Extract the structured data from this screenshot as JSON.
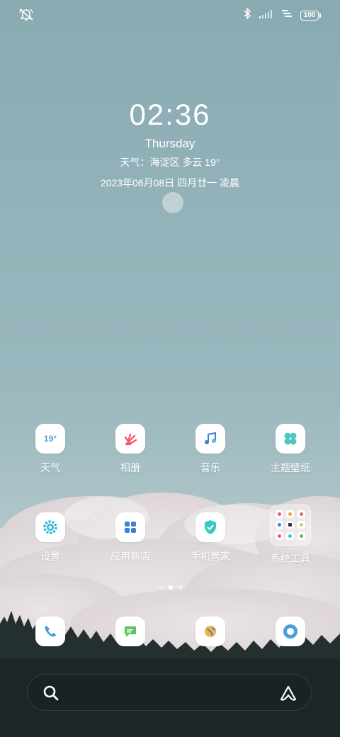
{
  "status_bar": {
    "battery": "100",
    "icons": [
      "mute-bell-icon",
      "bluetooth-icon",
      "signal-icon",
      "data-icon",
      "battery-icon"
    ]
  },
  "clock_widget": {
    "time": "02:36",
    "weekday": "Thursday",
    "weather": "天气：海淀区 多云 19°",
    "date": "2023年06月08日 四月廿一 凌晨"
  },
  "apps_row1": [
    {
      "label": "天气",
      "icon": "weather-icon",
      "text": "19°"
    },
    {
      "label": "相册",
      "icon": "gallery-icon"
    },
    {
      "label": "音乐",
      "icon": "music-icon"
    },
    {
      "label": "主题壁纸",
      "icon": "themes-icon"
    }
  ],
  "apps_row2": [
    {
      "label": "设置",
      "icon": "settings-icon"
    },
    {
      "label": "应用商店",
      "icon": "app-store-icon"
    },
    {
      "label": "手机管家",
      "icon": "security-icon"
    },
    {
      "label": "系统工具",
      "icon": "folder-icon"
    }
  ],
  "dock": [
    {
      "icon": "phone-icon"
    },
    {
      "icon": "messages-icon"
    },
    {
      "icon": "browser-icon"
    },
    {
      "icon": "camera-icon"
    }
  ],
  "page_indicator": {
    "pages": 3,
    "active": 1
  },
  "search_bar": {
    "icons": [
      "search-icon",
      "assistant-icon"
    ]
  },
  "colors": {
    "sky_top": "#8aaab2",
    "sky_bottom": "#a6c2c6",
    "cloud": "#e9dcdc",
    "forest": "#1f2a2c"
  }
}
